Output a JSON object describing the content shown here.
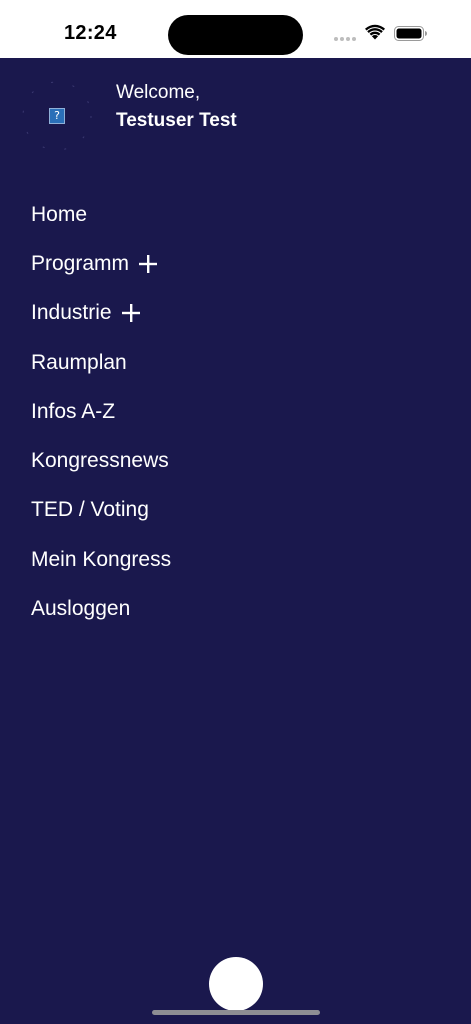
{
  "status_bar": {
    "time": "12:24",
    "icons": [
      "signal-dots-icon",
      "wifi-icon",
      "battery-icon"
    ]
  },
  "header": {
    "avatar_icon": "broken-image-icon",
    "avatar_placeholder": "?",
    "welcome": "Welcome,",
    "username": "Testuser Test"
  },
  "menu": {
    "items": [
      {
        "label": "Home"
      },
      {
        "label": "Programm",
        "expand_icon": "plus-icon"
      },
      {
        "label": "Industrie",
        "expand_icon": "plus-icon"
      },
      {
        "label": "Raumplan"
      },
      {
        "label": "Infos A-Z"
      },
      {
        "label": "Kongressnews"
      },
      {
        "label": "TED / Voting"
      },
      {
        "label": "Mein Kongress"
      },
      {
        "label": "Ausloggen"
      }
    ]
  },
  "colors": {
    "background": "#1a184d",
    "text": "#ffffff",
    "status_bar": "#ffffff"
  }
}
